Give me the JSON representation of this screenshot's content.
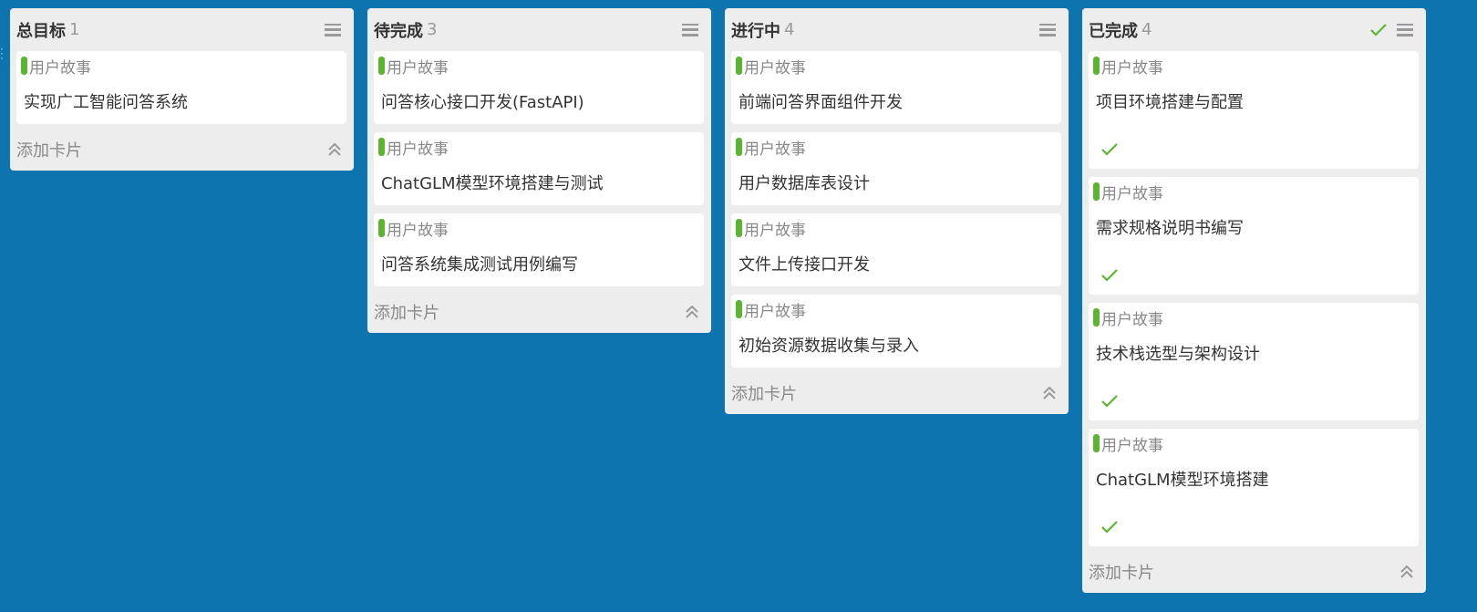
{
  "colors": {
    "background": "#0e74b0",
    "tag": "#5cb531"
  },
  "columns": [
    {
      "title": "总目标",
      "count": "1",
      "done": false,
      "cards": [
        {
          "tag": "用户故事",
          "title": "实现广工智能问答系统"
        }
      ],
      "add_label": "添加卡片"
    },
    {
      "title": "待完成",
      "count": "3",
      "done": false,
      "cards": [
        {
          "tag": "用户故事",
          "title": "问答核心接口开发(FastAPI)"
        },
        {
          "tag": "用户故事",
          "title": "ChatGLM模型环境搭建与测试"
        },
        {
          "tag": "用户故事",
          "title": "问答系统集成测试用例编写"
        }
      ],
      "add_label": "添加卡片"
    },
    {
      "title": "进行中",
      "count": "4",
      "done": false,
      "cards": [
        {
          "tag": "用户故事",
          "title": "前端问答界面组件开发"
        },
        {
          "tag": "用户故事",
          "title": "用户数据库表设计"
        },
        {
          "tag": "用户故事",
          "title": "文件上传接口开发"
        },
        {
          "tag": "用户故事",
          "title": "初始资源数据收集与录入"
        }
      ],
      "add_label": "添加卡片"
    },
    {
      "title": "已完成",
      "count": "4",
      "done": true,
      "cards": [
        {
          "tag": "用户故事",
          "title": "项目环境搭建与配置"
        },
        {
          "tag": "用户故事",
          "title": "需求规格说明书编写"
        },
        {
          "tag": "用户故事",
          "title": "技术栈选型与架构设计"
        },
        {
          "tag": "用户故事",
          "title": "ChatGLM模型环境搭建"
        }
      ],
      "add_label": "添加卡片"
    }
  ]
}
